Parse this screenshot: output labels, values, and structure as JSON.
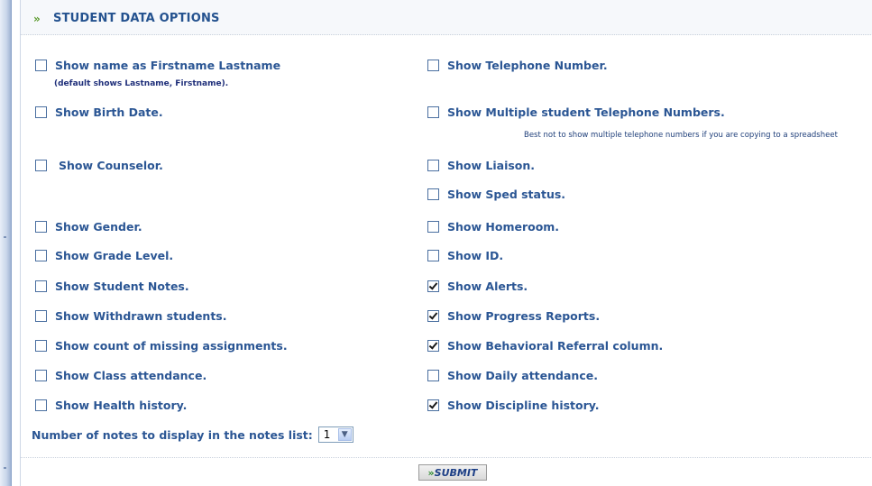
{
  "header": {
    "title": "STUDENT DATA OPTIONS",
    "chevron": "»"
  },
  "options_left": [
    {
      "label": "Show name as Firstname Lastname",
      "checked": false,
      "sublabel": "(default shows Lastname, Firstname)."
    },
    {
      "label": "Show Birth Date.",
      "checked": false
    },
    {
      "label": "Show Counselor.",
      "checked": false
    },
    {
      "label": "Show Gender.",
      "checked": false
    },
    {
      "label": "Show Grade Level.",
      "checked": false
    },
    {
      "label": "Show Student Notes.",
      "checked": false
    },
    {
      "label": "Show Withdrawn students.",
      "checked": false
    },
    {
      "label": "Show count of missing assignments.",
      "checked": false
    },
    {
      "label": "Show Class attendance.",
      "checked": false
    },
    {
      "label": "Show Health history.",
      "checked": false
    }
  ],
  "options_right": [
    {
      "label": "Show Telephone Number.",
      "checked": false
    },
    {
      "label": "Show Multiple student Telephone Numbers.",
      "checked": false,
      "note": "Best not to show multiple telephone numbers if you are copying to a spreadsheet"
    },
    {
      "label": "Show Liaison.",
      "checked": false
    },
    {
      "label": "Show Sped status.",
      "checked": false
    },
    {
      "label": "Show Homeroom.",
      "checked": false
    },
    {
      "label": "Show ID.",
      "checked": false
    },
    {
      "label": "Show Alerts.",
      "checked": true
    },
    {
      "label": "Show Progress Reports.",
      "checked": true
    },
    {
      "label": "Show Behavioral Referral column.",
      "checked": true
    },
    {
      "label": "Show Daily attendance.",
      "checked": false
    },
    {
      "label": "Show Discipline history.",
      "checked": true
    }
  ],
  "notes_count": {
    "label": "Number of notes to display in the notes list:",
    "selected": "1"
  },
  "submit": {
    "label": "SUBMIT",
    "chevron": "»"
  }
}
